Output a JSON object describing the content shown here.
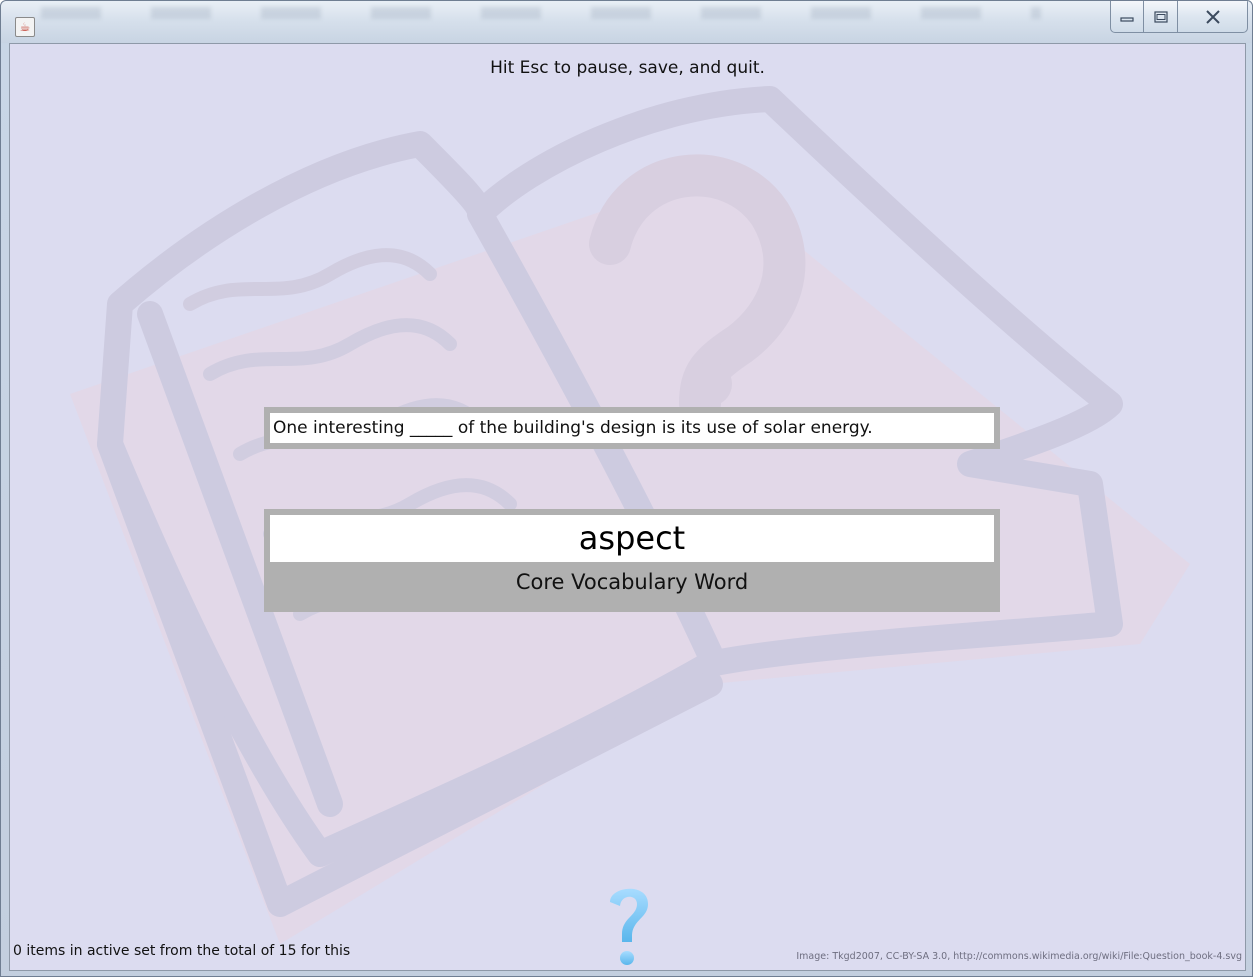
{
  "window": {
    "app_icon": "java-coffee-icon",
    "controls": [
      "minimize-icon",
      "maximize-icon",
      "close-icon"
    ]
  },
  "quiz": {
    "hint": "Hit Esc to pause, save, and quit.",
    "sentence": "One interesting _____ of the building's design is its use of solar energy.",
    "word": "aspect",
    "word_category": "Core Vocabulary Word"
  },
  "footer": {
    "status": "0 items in active set from the total of 15 for this",
    "image_credit": "Image: Tkgd2007, CC-BY-SA 3.0, http://commons.wikimedia.org/wiki/File:Question_book-4.svg",
    "help_icon": "question-mark-icon"
  },
  "colors": {
    "background": "#dcdcf0",
    "card_border": "#b0b0b0",
    "help_icon": "#7ec8f0"
  }
}
